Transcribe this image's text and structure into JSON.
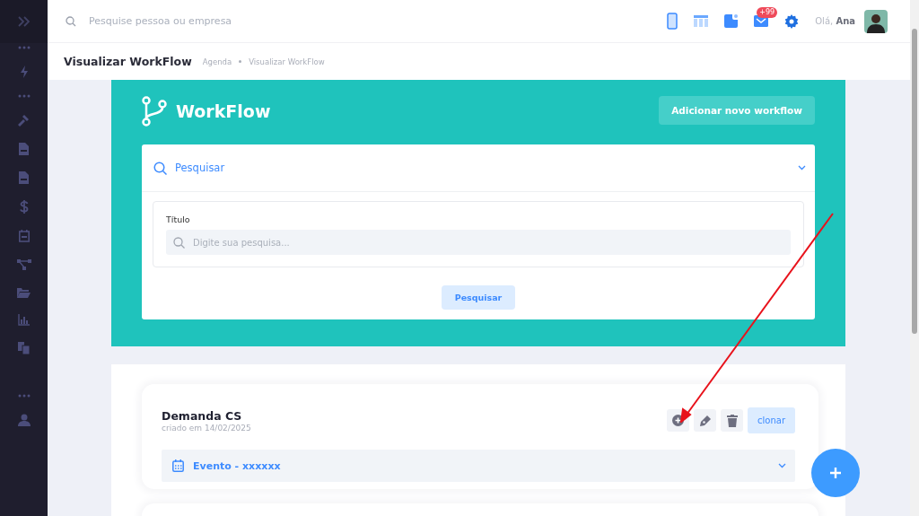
{
  "topbar": {
    "search_placeholder": "Pesquise pessoa ou empresa",
    "notification_badge": "+99",
    "greeting": "Olá,",
    "user_name": "Ana"
  },
  "page_header": {
    "title": "Visualizar WorkFlow",
    "breadcrumb": [
      "Agenda",
      "Visualizar WorkFlow"
    ]
  },
  "workflow_panel": {
    "title": "WorkFlow",
    "add_button": "Adicionar novo workflow",
    "search": {
      "header": "Pesquisar",
      "expanded": true,
      "field_label": "Título",
      "placeholder": "Digite sua pesquisa...",
      "submit": "Pesquisar"
    }
  },
  "workflows": [
    {
      "name": "Demanda CS",
      "created": "criado em 14/02/2025",
      "clone_button": "clonar",
      "event": "Evento - xxxxxx"
    }
  ]
}
